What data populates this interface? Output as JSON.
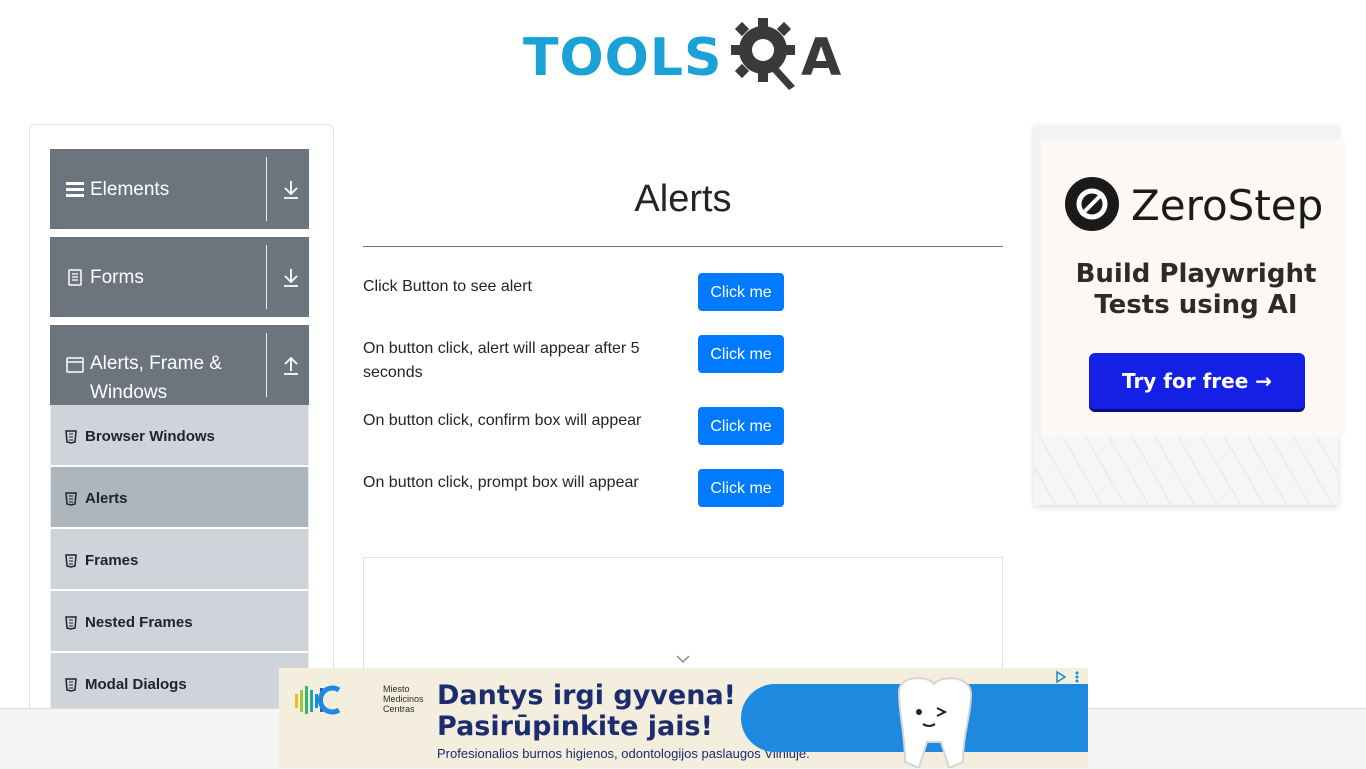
{
  "header": {
    "logo_text_primary": "TOOLS",
    "logo_text_secondary": "A"
  },
  "sidebar": {
    "groups": [
      {
        "label": "Elements",
        "icon": "hamburger-icon",
        "arrow": "download-arrow-icon"
      },
      {
        "label": "Forms",
        "icon": "document-icon",
        "arrow": "download-arrow-icon"
      },
      {
        "label": "Alerts, Frame & Windows",
        "icon": "window-icon",
        "arrow": "upload-arrow-icon"
      }
    ],
    "items": [
      {
        "label": "Browser Windows",
        "active": false
      },
      {
        "label": "Alerts",
        "active": true
      },
      {
        "label": "Frames",
        "active": false
      },
      {
        "label": "Nested Frames",
        "active": false
      },
      {
        "label": "Modal Dialogs",
        "active": false
      }
    ]
  },
  "main": {
    "title": "Alerts",
    "rows": [
      {
        "label": "Click Button to see alert",
        "button": "Click me"
      },
      {
        "label": "On button click, alert will appear after 5 seconds",
        "button": "Click me"
      },
      {
        "label": "On button click, confirm box will appear",
        "button": "Click me"
      },
      {
        "label": "On button click, prompt box will appear",
        "button": "Click me"
      }
    ]
  },
  "right_ad": {
    "brand": "ZeroStep",
    "tagline": "Build Playwright Tests using AI",
    "cta": "Try for free →"
  },
  "bottom_ad": {
    "brand": "Miesto Medicinos Centras",
    "headline_1": "Dantys irgi gyvena!",
    "headline_2": "Pasirūpinkite jais!",
    "subline": "Profesionalios burnos higienos, odontologijos paslaugos Vilniuje."
  },
  "colors": {
    "primary_button": "#007bff",
    "sidebar_header": "#6c757d",
    "sidebar_item": "#ced4da",
    "sidebar_item_active": "#adb5bd",
    "logo_blue": "#1aa1d6",
    "ad_cta": "#1420e6"
  }
}
